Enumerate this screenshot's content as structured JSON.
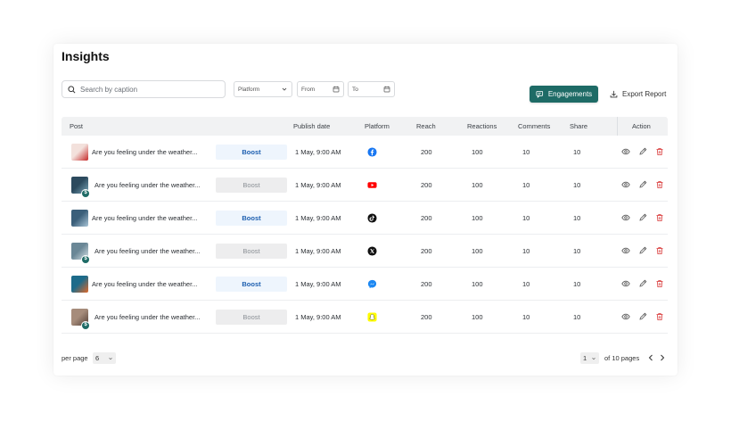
{
  "page": {
    "title": "Insights"
  },
  "filters": {
    "search_placeholder": "Search by caption",
    "platform_label": "Platform",
    "from_label": "From",
    "to_label": "To"
  },
  "actions": {
    "engagements_label": "Engagements",
    "export_label": "Export Report"
  },
  "table": {
    "headers": {
      "post": "Post",
      "publish_date": "Publish date",
      "platform": "Platform",
      "reach": "Reach",
      "reactions": "Reactions",
      "comments": "Comments",
      "share": "Share",
      "action": "Action"
    },
    "rows": [
      {
        "caption": "Are you feeling under the weather...",
        "boost": "Boost",
        "boost_active": true,
        "date": "1 May, 9:00 AM",
        "platform_icon": "facebook-icon",
        "reach": "200",
        "reactions": "100",
        "comments": "10",
        "share": "10",
        "has_badge": false
      },
      {
        "caption": "Are you feeling under the weather...",
        "boost": "Boost",
        "boost_active": false,
        "date": "1 May, 9:00 AM",
        "platform_icon": "youtube-icon",
        "reach": "200",
        "reactions": "100",
        "comments": "10",
        "share": "10",
        "has_badge": true
      },
      {
        "caption": "Are you feeling under the weather...",
        "boost": "Boost",
        "boost_active": true,
        "date": "1 May, 9:00 AM",
        "platform_icon": "tiktok-icon",
        "reach": "200",
        "reactions": "100",
        "comments": "10",
        "share": "10",
        "has_badge": false
      },
      {
        "caption": "Are you feeling under the weather...",
        "boost": "Boost",
        "boost_active": false,
        "date": "1 May, 9:00 AM",
        "platform_icon": "x-icon",
        "reach": "200",
        "reactions": "100",
        "comments": "10",
        "share": "10",
        "has_badge": true
      },
      {
        "caption": "Are you feeling under the weather...",
        "boost": "Boost",
        "boost_active": true,
        "date": "1 May, 9:00 AM",
        "platform_icon": "messenger-icon",
        "reach": "200",
        "reactions": "100",
        "comments": "10",
        "share": "10",
        "has_badge": false
      },
      {
        "caption": "Are you feeling under the weather...",
        "boost": "Boost",
        "boost_active": false,
        "date": "1 May, 9:00 AM",
        "platform_icon": "snapchat-icon",
        "reach": "200",
        "reactions": "100",
        "comments": "10",
        "share": "10",
        "has_badge": true
      }
    ]
  },
  "pagination": {
    "per_page_label": "per page",
    "per_page_value": "6",
    "current_page": "1",
    "of_pages_text": "of 10 pages"
  },
  "colors": {
    "accent": "#1e6b66",
    "boost_active_text": "#1d5fb0",
    "delete": "#d93a3a"
  }
}
